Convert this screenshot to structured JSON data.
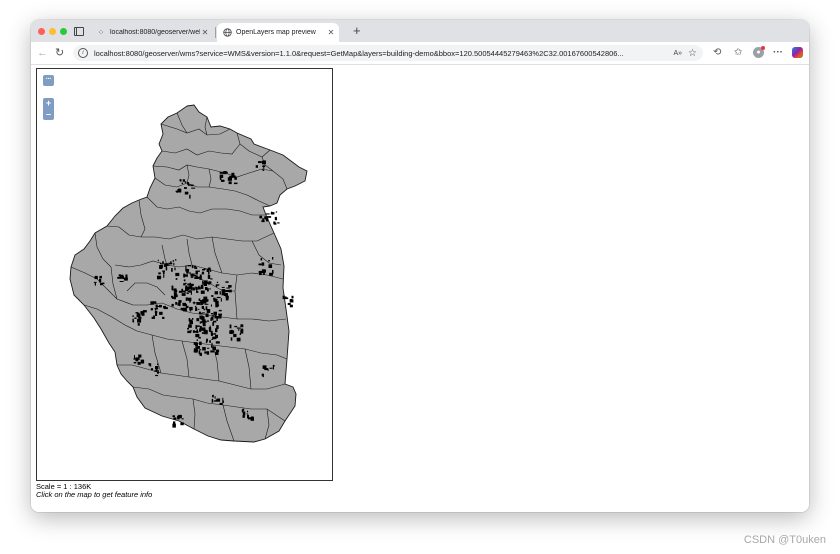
{
  "browser": {
    "tabs": [
      {
        "title": "localhost:8080/geoserver/web/...",
        "favicon": "geoserver-icon",
        "close": "✕"
      },
      {
        "title": "OpenLayers map preview",
        "favicon": "globe-icon",
        "close": "✕"
      }
    ],
    "new_tab": "+",
    "url": "localhost:8080/geoserver/wms?service=WMS&version=1.1.0&request=GetMap&layers=building-demo&bbox=120.50054445279463%2C32.00167600542806..."
  },
  "map": {
    "toolbar_toggle": "···",
    "zoom_in": "+",
    "zoom_out": "–",
    "scale_text": "Scale = 1 : 136K",
    "hint": "Click on the map to get feature info",
    "fill_color": "#a8a8a8",
    "outline_color": "#1a1a1a",
    "building_color": "#000000"
  },
  "watermark": "CSDN @T0uken"
}
